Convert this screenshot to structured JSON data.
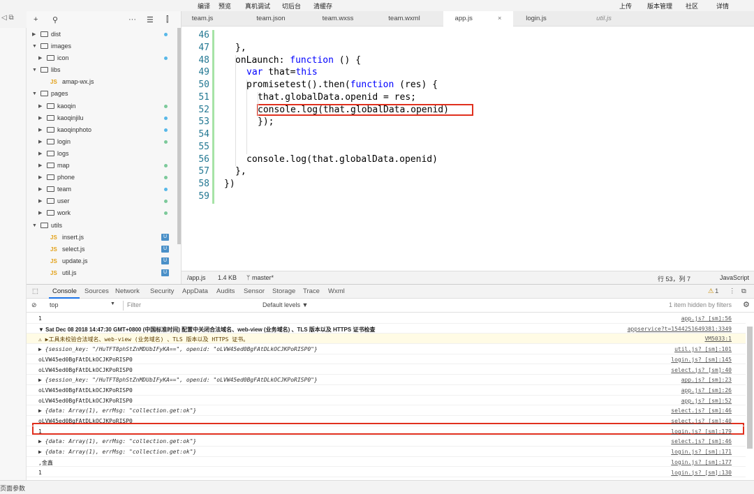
{
  "menu": {
    "left": [
      "编译",
      "预览",
      "真机调试",
      "切后台",
      "清缓存"
    ],
    "right": [
      "上传",
      "版本管理",
      "社区",
      "详情"
    ]
  },
  "explorer": {
    "header_icons": [
      "plus-icon",
      "search-icon",
      "more-icon",
      "collapse-icon",
      "split-icon"
    ],
    "tree": [
      {
        "indent": 0,
        "type": "folder",
        "open": false,
        "name": "dist",
        "dot": "#58b8e8"
      },
      {
        "indent": 0,
        "type": "folder",
        "open": true,
        "name": "images",
        "dot": ""
      },
      {
        "indent": 1,
        "type": "folder",
        "open": false,
        "name": "icon",
        "dot": "#58b8e8"
      },
      {
        "indent": 0,
        "type": "folder",
        "open": true,
        "name": "libs",
        "dot": ""
      },
      {
        "indent": 1,
        "type": "js",
        "name": "amap-wx.js",
        "dot": ""
      },
      {
        "indent": 0,
        "type": "folder",
        "open": true,
        "name": "pages",
        "dot": ""
      },
      {
        "indent": 1,
        "type": "folder",
        "open": false,
        "name": "kaoqin",
        "dot": "#7cc99a"
      },
      {
        "indent": 1,
        "type": "folder",
        "open": false,
        "name": "kaoqinjilu",
        "dot": "#58b8e8"
      },
      {
        "indent": 1,
        "type": "folder",
        "open": false,
        "name": "kaoqinphoto",
        "dot": "#58b8e8"
      },
      {
        "indent": 1,
        "type": "folder",
        "open": false,
        "name": "login",
        "dot": "#7cc99a"
      },
      {
        "indent": 1,
        "type": "folder",
        "open": false,
        "name": "logs",
        "dot": ""
      },
      {
        "indent": 1,
        "type": "folder",
        "open": false,
        "name": "map",
        "dot": "#7cc99a"
      },
      {
        "indent": 1,
        "type": "folder",
        "open": false,
        "name": "phone",
        "dot": "#7cc99a"
      },
      {
        "indent": 1,
        "type": "folder",
        "open": false,
        "name": "team",
        "dot": "#58b8e8"
      },
      {
        "indent": 1,
        "type": "folder",
        "open": false,
        "name": "user",
        "dot": "#7cc99a"
      },
      {
        "indent": 1,
        "type": "folder",
        "open": false,
        "name": "work",
        "dot": "#7cc99a"
      },
      {
        "indent": 0,
        "type": "folder",
        "open": true,
        "name": "utils",
        "dot": ""
      },
      {
        "indent": 1,
        "type": "js",
        "name": "insert.js",
        "badge": "U"
      },
      {
        "indent": 1,
        "type": "js",
        "name": "select.js",
        "badge": "U"
      },
      {
        "indent": 1,
        "type": "js",
        "name": "update.js",
        "badge": "U"
      },
      {
        "indent": 1,
        "type": "js",
        "name": "util.js",
        "badge": "U"
      }
    ]
  },
  "tabs": [
    {
      "label": "team.js",
      "active": false,
      "italic": false
    },
    {
      "label": "team.json",
      "active": false,
      "italic": false
    },
    {
      "label": "team.wxss",
      "active": false,
      "italic": false
    },
    {
      "label": "team.wxml",
      "active": false,
      "italic": false
    },
    {
      "label": "app.js",
      "active": true,
      "italic": false,
      "close": "×"
    },
    {
      "label": "login.js",
      "active": false,
      "italic": false
    },
    {
      "label": "util.js",
      "active": false,
      "italic": true
    }
  ],
  "code": {
    "lines": [
      {
        "n": "46",
        "indent": 0,
        "parts": [
          {
            "t": ""
          }
        ]
      },
      {
        "n": "47",
        "indent": 1,
        "parts": [
          {
            "t": "},"
          }
        ]
      },
      {
        "n": "48",
        "indent": 1,
        "parts": [
          {
            "t": "onLaunch: "
          },
          {
            "t": "function",
            "kw": true
          },
          {
            "t": " () {"
          }
        ]
      },
      {
        "n": "49",
        "indent": 2,
        "parts": [
          {
            "t": "var",
            "kw": true
          },
          {
            "t": " that="
          },
          {
            "t": "this",
            "kw": true
          }
        ]
      },
      {
        "n": "50",
        "indent": 2,
        "parts": [
          {
            "t": "promisetest().then("
          },
          {
            "t": "function",
            "kw": true
          },
          {
            "t": " (res) {"
          }
        ]
      },
      {
        "n": "51",
        "indent": 3,
        "parts": [
          {
            "t": "that.globalData.openid = res;"
          }
        ]
      },
      {
        "n": "52",
        "indent": 3,
        "parts": [
          {
            "t": "console.log(that.globalData.openid)"
          }
        ]
      },
      {
        "n": "53",
        "indent": 3,
        "parts": [
          {
            "t": "});"
          }
        ]
      },
      {
        "n": "54",
        "indent": 0,
        "parts": [
          {
            "t": ""
          }
        ]
      },
      {
        "n": "55",
        "indent": 0,
        "parts": [
          {
            "t": ""
          }
        ]
      },
      {
        "n": "56",
        "indent": 2,
        "parts": [
          {
            "t": "console.log(that.globalData.openid)"
          }
        ]
      },
      {
        "n": "57",
        "indent": 1,
        "parts": [
          {
            "t": "},"
          }
        ]
      },
      {
        "n": "58",
        "indent": 0,
        "parts": [
          {
            "t": "})"
          }
        ]
      },
      {
        "n": "59",
        "indent": 0,
        "parts": [
          {
            "t": ""
          }
        ]
      }
    ]
  },
  "status": {
    "path": "/app.js",
    "size": "1.4 KB",
    "branch": "master*",
    "position": "行 53，列 7",
    "language": "JavaScript"
  },
  "devtools": {
    "tabs": [
      "Console",
      "Sources",
      "Network",
      "Security",
      "AppData",
      "Audits",
      "Sensor",
      "Storage",
      "Trace",
      "Wxml"
    ],
    "warn_count": "1",
    "context": "top",
    "filter_placeholder": "Filter",
    "levels": "Default levels ▼",
    "hidden": "1 item hidden by filters"
  },
  "console_rows": [
    {
      "msg": "1",
      "src": "app.js? [sm]:56",
      "kind": "plain"
    },
    {
      "msg": "▼ Sat Dec 08 2018 14:47:30 GMT+0800 (中国标准时间) 配置中关闭合法域名、web-view (业务域名) 、TLS 版本以及 HTTPS 证书检查",
      "src": "appservice?t=1544251649381:3349",
      "kind": "bold"
    },
    {
      "msg": "⚠ ▶工具未校验合法域名、web-view (业务域名) 、TLS 版本以及 HTTPS 证书。",
      "src": "VM5033:1",
      "kind": "warn"
    },
    {
      "msg": "▶ {session_key: \"/HuTFT8phStZnMDUbIFyKA==\", openid: \"oLVW45ed0BgFAtDLkOCJKPoRISP0\"}",
      "src": "util.js? [sm]:101",
      "kind": "obj"
    },
    {
      "msg": "oLVW45ed0BgFAtDLkOCJKPoRISP0",
      "src": "login.js? [sm]:145",
      "kind": "plain"
    },
    {
      "msg": "oLVW45ed0BgFAtDLkOCJKPoRISP0",
      "src": "select.js? [sm]:40",
      "kind": "plain"
    },
    {
      "msg": "▶ {session_key: \"/HuTFT8phStZnMDUbIFyKA==\", openid: \"oLVW45ed0BgFAtDLkOCJKPoRISP0\"}",
      "src": "app.js? [sm]:23",
      "kind": "obj"
    },
    {
      "msg": "oLVW45ed0BgFAtDLkOCJKPoRISP0",
      "src": "app.js? [sm]:26",
      "kind": "plain"
    },
    {
      "msg": "oLVW45ed0BgFAtDLkOCJKPoRISP0",
      "src": "app.js? [sm]:52",
      "kind": "plain"
    },
    {
      "msg": "▶ {data: Array(1), errMsg: \"collection.get:ok\"}",
      "src": "select.js? [sm]:46",
      "kind": "obj"
    },
    {
      "msg": "oLVW45ed0BgFAtDLkOCJKPoRISP0",
      "src": "select.js? [sm]:40",
      "kind": "plain"
    },
    {
      "msg": "1",
      "src": "login.js? [sm]:179",
      "kind": "plain"
    },
    {
      "msg": "▶ {data: Array(1), errMsg: \"collection.get:ok\"}",
      "src": "select.js? [sm]:46",
      "kind": "obj"
    },
    {
      "msg": "▶ {data: Array(1), errMsg: \"collection.get:ok\"}",
      "src": "login.js? [sm]:171",
      "kind": "obj"
    },
    {
      "msg": ",金鑫",
      "src": "login.js? [sm]:177",
      "kind": "plain"
    },
    {
      "msg": "1",
      "src": "login.js? [sm]:130",
      "kind": "plain"
    }
  ],
  "bottom": {
    "label": "页面参数"
  }
}
